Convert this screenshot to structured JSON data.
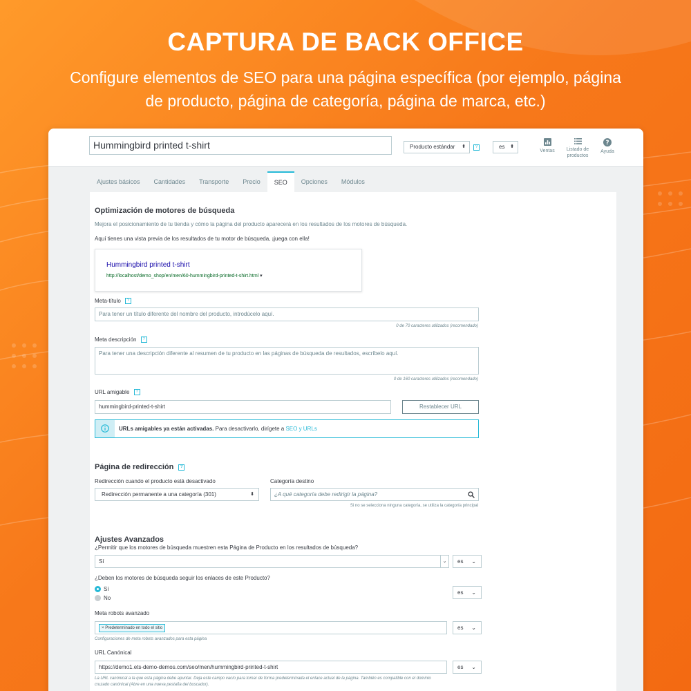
{
  "hero": {
    "title": "CAPTURA DE BACK OFFICE",
    "subtitle": "Configure elementos de SEO para una página específica (por ejemplo, página de producto, página de categoría, página de marca, etc.)"
  },
  "topbar": {
    "product_name": "Hummingbird printed t-shirt",
    "product_type": "Producto estándar",
    "language": "es",
    "buttons": [
      {
        "label": "Ventas",
        "icon": "chart-icon"
      },
      {
        "label": "Listado de productos",
        "icon": "list-icon"
      },
      {
        "label": "Ayuda",
        "icon": "help-icon"
      }
    ]
  },
  "tabs": [
    "Ajustes básicos",
    "Cantidades",
    "Transporte",
    "Precio",
    "SEO",
    "Opciones",
    "Módulos"
  ],
  "active_tab": "SEO",
  "seo": {
    "title": "Optimización de motores de búsqueda",
    "description": "Mejora el posicionamiento de tu tienda y cómo la página del producto aparecerá en los resultados de los motores de búsqueda.",
    "preview_intro": "Aquí tienes una vista previa de los resultados de tu motor de búsqueda, ¡juega con ella!",
    "preview_title": "Hummingbird printed t-shirt",
    "preview_url": "http://localhost/demo_shop/en/men/60-hummingbird-printed-t-shirt.html",
    "meta_title_label": "Meta-título",
    "meta_title_placeholder": "Para tener un título diferente del nombre del producto, introdúcelo aquí.",
    "meta_title_counter": "0 de 70 caracteres utilizados (recomendado)",
    "meta_desc_label": "Meta descripción",
    "meta_desc_placeholder": "Para tener una descripción diferente al resumen de tu producto en las páginas de búsqueda de resultados, escríbelo aquí.",
    "meta_desc_counter": "0 de 160 caracteres utilizados (recomendado)",
    "url_label": "URL amigable",
    "url_value": "hummingbird-printed-t-shirt",
    "reset_url_label": "Restablecer URL",
    "alert_bold": "URLs amigables ya están activadas.",
    "alert_text": " Para desactivarlo, dirígete a ",
    "alert_link": "SEO y URLs"
  },
  "redirect": {
    "title": "Página de redirección",
    "when_disabled_label": "Redirección cuando el producto está desactivado",
    "when_disabled_value": "Redirección permanente a una categoría (301)",
    "target_label": "Categoría destino",
    "target_placeholder": "¿A qué categoría debe redirigir la página?",
    "target_note": "Si no se selecciona ninguna categoría, se utiliza la categoría principal"
  },
  "advanced": {
    "title": "Ajustes Avanzados",
    "allow_label": "¿Permitir que los motores de búsqueda muestren esta Página de Producto en los resultados de búsqueda?",
    "allow_value": "Sí",
    "follow_label": "¿Deben los motores de búsqueda seguir los enlaces de este Producto?",
    "follow_options": [
      "Sí",
      "No"
    ],
    "robots_label": "Meta robots avanzado",
    "robots_tag": "Predeterminado en todo el sitio",
    "robots_note": "Configuraciones de meta robots avanzados para esta página",
    "canonical_label": "URL Canónical",
    "canonical_value": "https://demo1.ets-demo-demos.com/seo/men/hummingbird-printed-t-shirt",
    "canonical_note": "La URL canónical a la que esta página debe apuntar. Deja este campo vacío para tomar de forma predeterminada el enlace actual de la página. También es compatible con el dominio cruzado canónical (Abre en una nueva pestaña del buscador).",
    "lang": "es"
  },
  "colors": {
    "accent": "#25b9d7",
    "orange": "#f7781a",
    "text": "#363a41",
    "muted": "#6c868e"
  }
}
